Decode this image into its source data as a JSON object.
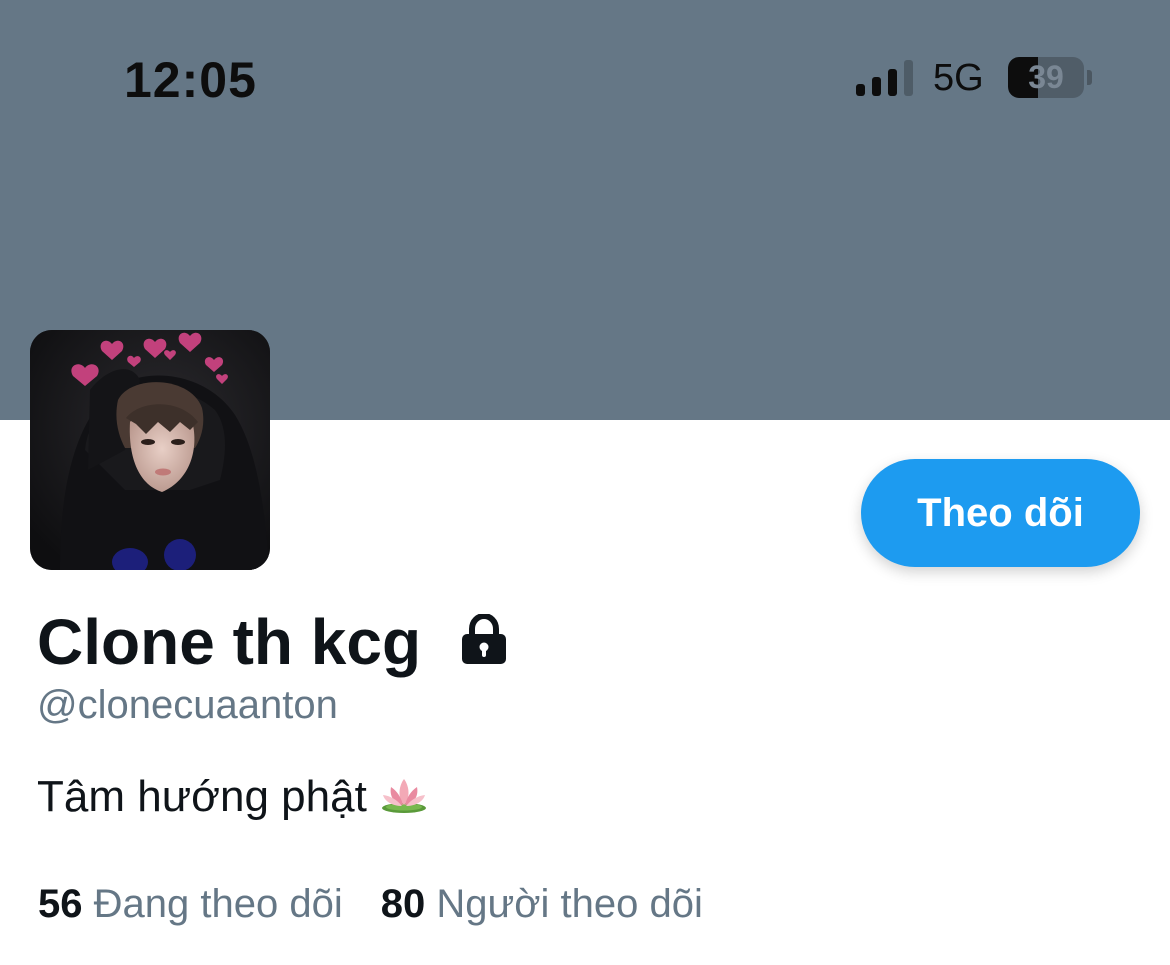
{
  "status_bar": {
    "time": "12:05",
    "network": "5G",
    "battery_level": "39",
    "battery_fraction": 0.39,
    "signal_bars_active": 3,
    "signal_bars_total": 4
  },
  "profile": {
    "banner_color": "#657786",
    "display_name": "Clone th kcg",
    "handle": "@clonecuaanton",
    "bio": "Tâm hướng phật",
    "protected": true,
    "bio_emoji_icon": "lotus-icon",
    "avatar_icon": "profile-avatar-photo"
  },
  "actions": {
    "follow_label": "Theo dõi",
    "follow_color": "#1d9bf0"
  },
  "stats": {
    "following_count": "56",
    "following_label": "Đang theo dõi",
    "followers_count": "80",
    "followers_label": "Người theo dõi"
  }
}
